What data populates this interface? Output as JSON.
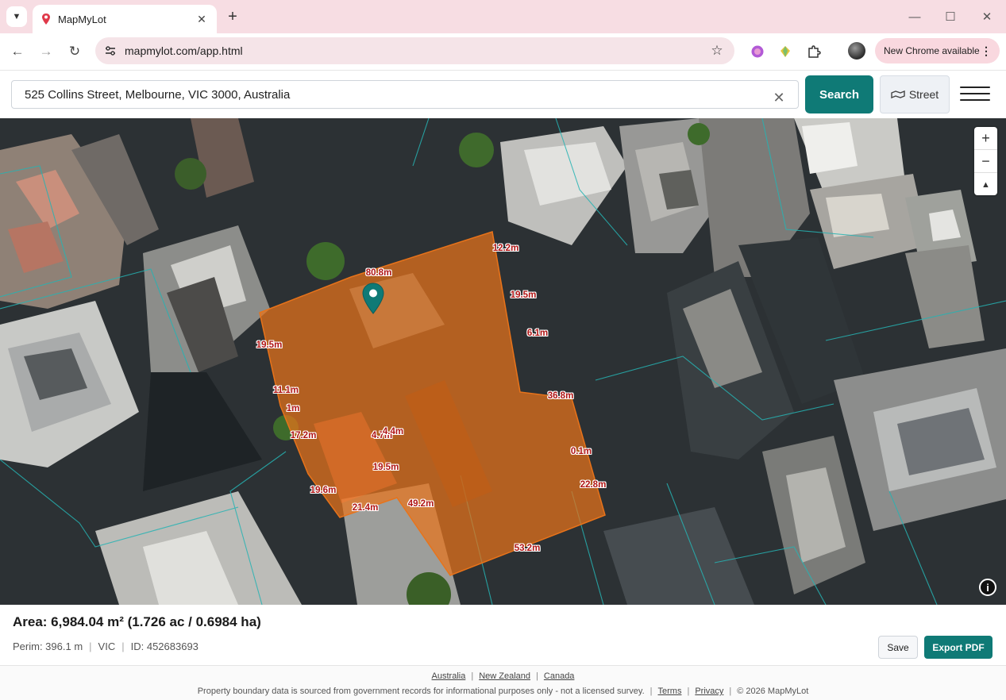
{
  "browser": {
    "tab_title": "MapMyLot",
    "url": "mapmylot.com/app.html",
    "update_label": "New Chrome available"
  },
  "header": {
    "search_value": "525 Collins Street, Melbourne, VIC 3000, Australia",
    "search_button": "Search",
    "street_button": "Street"
  },
  "map": {
    "boundary_color": "#e8731a",
    "measurements": [
      "12.2m",
      "80.8m",
      "19.5m",
      "19.5m",
      "6.1m",
      "11.1m",
      "36.8m",
      "1m",
      "17.2m",
      "4.7m",
      "4.4m",
      "0.1m",
      "19.5m",
      "19.6m",
      "22.8m",
      "21.4m",
      "49.2m",
      "53.2m"
    ],
    "zoom_in": "+",
    "zoom_out": "−",
    "compass": "▲",
    "info": "i"
  },
  "info_panel": {
    "area": "Area: 6,984.04 m²  (1.726 ac / 0.6984 ha)",
    "perimeter": "Perim: 396.1 m",
    "state": "VIC",
    "id": "ID: 452683693",
    "save": "Save",
    "export": "Export PDF"
  },
  "footer": {
    "links": [
      "Australia",
      "New Zealand",
      "Canada"
    ],
    "disclaimer": "Property boundary data is sourced from government records for informational purposes only - not a licensed survey.",
    "terms": "Terms",
    "privacy": "Privacy",
    "copyright": "© 2026 MapMyLot"
  },
  "colors": {
    "accent": "#0f7a76",
    "tabstrip": "#f7dde3",
    "measure_text": "#b01515"
  }
}
